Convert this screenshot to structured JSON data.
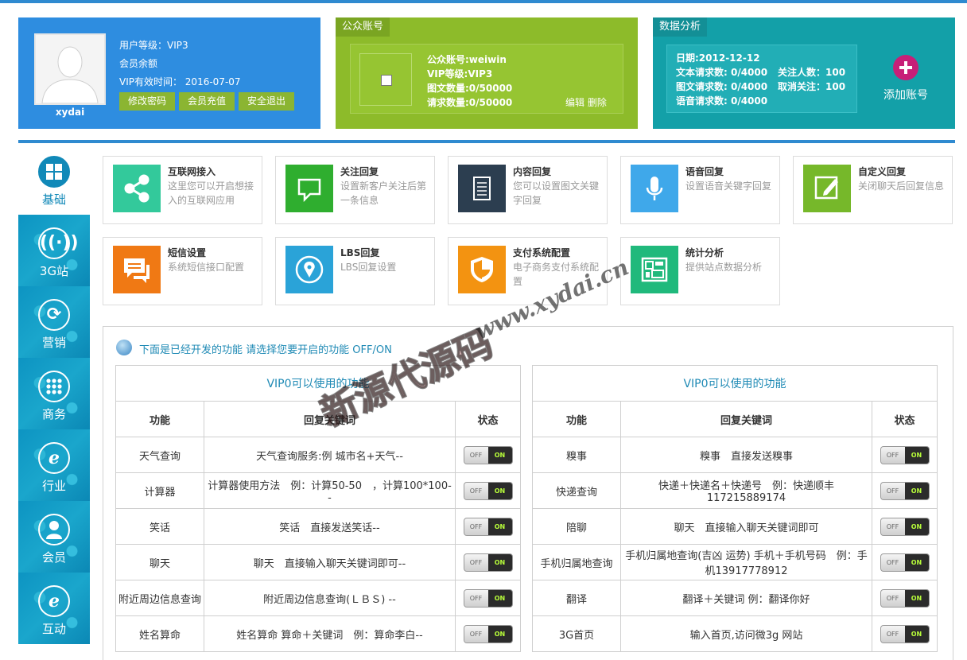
{
  "user": {
    "name": "xydai",
    "level": "用户等级：VIP3",
    "balance": "会员余额",
    "expire": "VIP有效时间： 2016-07-07",
    "buttons": [
      "修改密码",
      "会员充值",
      "安全退出"
    ]
  },
  "account": {
    "title": "公众账号",
    "lines": [
      "公众账号:weiwin",
      "VIP等级:VIP3",
      "图文数量:0/50000",
      "请求数量:0/50000"
    ],
    "edit": "编辑",
    "delete": "删除"
  },
  "data": {
    "title": "数据分析",
    "date": "日期:2012-12-12",
    "text_req": "文本请求数: 0/4000",
    "img_req": "图文请求数: 0/4000",
    "voice_req": "语音请求数: 0/4000",
    "follow": "关注人数：100",
    "unfollow": "取消关注：100",
    "add": "添加账号"
  },
  "sidebar": [
    {
      "label": "基础",
      "icon": "grid-icon"
    },
    {
      "label": "3G站",
      "icon": "signal-icon"
    },
    {
      "label": "营销",
      "icon": "refresh-icon"
    },
    {
      "label": "商务",
      "icon": "dots-grid-icon"
    },
    {
      "label": "行业",
      "icon": "ie-icon"
    },
    {
      "label": "会员",
      "icon": "person-icon"
    },
    {
      "label": "互动",
      "icon": "ie-icon"
    }
  ],
  "cards": [
    {
      "title": "互联网接入",
      "desc": "这里您可以开启想接入的互联网应用",
      "color": "#33c99b",
      "icon": "share-icon"
    },
    {
      "title": "关注回复",
      "desc": "设置新客户关注后第一条信息",
      "color": "#2fae2f",
      "icon": "speech-bubble-icon"
    },
    {
      "title": "内容回复",
      "desc": "您可以设置图文关键字回复",
      "color": "#2c3e50",
      "icon": "document-icon"
    },
    {
      "title": "语音回复",
      "desc": "设置语音关键字回复",
      "color": "#3fa8ea",
      "icon": "microphone-icon"
    },
    {
      "title": "自定义回复",
      "desc": "关闭聊天后回复信息",
      "color": "#76b82a",
      "icon": "edit-icon"
    },
    {
      "title": "短信设置",
      "desc": "系统短信接口配置",
      "color": "#f07914",
      "icon": "chat-icon"
    },
    {
      "title": "LBS回复",
      "desc": "LBS回复设置",
      "color": "#2aa3d8",
      "icon": "location-icon"
    },
    {
      "title": "支付系统配置",
      "desc": "电子商务支付系统配置",
      "color": "#f39311",
      "icon": "shield-icon"
    },
    {
      "title": "统计分析",
      "desc": "提供站点数据分析",
      "color": "#20b97c",
      "icon": "dashboard-icon"
    }
  ],
  "notice": "下面是已经开发的功能 请选择您要开启的功能 OFF/ON",
  "table_left": {
    "caption": "VIP0可以使用的功能",
    "headers": [
      "功能",
      "回复关键词",
      "状态"
    ],
    "rows": [
      [
        "天气查询",
        "天气查询服务:例 城市名+天气--"
      ],
      [
        "计算器",
        "计算器使用方法　例：计算50-50　，计算100*100--"
      ],
      [
        "笑话",
        "笑话　直接发送笑话--"
      ],
      [
        "聊天",
        "聊天　直接输入聊天关键词即可--"
      ],
      [
        "附近周边信息查询",
        "附近周边信息查询(ＬＢＳ) --"
      ],
      [
        "姓名算命",
        "姓名算命 算命＋关键词　例：算命李白--"
      ]
    ]
  },
  "table_right": {
    "caption": "VIP0可以使用的功能",
    "headers": [
      "功能",
      "回复关键词",
      "状态"
    ],
    "rows": [
      [
        "糗事",
        "糗事　直接发送糗事"
      ],
      [
        "快递查询",
        "快递＋快递名＋快递号　例：快递顺丰117215889174"
      ],
      [
        "陪聊",
        "聊天　直接输入聊天关键词即可"
      ],
      [
        "手机归属地查询",
        "手机归属地查询(吉凶 运势) 手机＋手机号码　例：手机13917778912"
      ],
      [
        "翻译",
        "翻译＋关键词 例：翻译你好"
      ],
      [
        "3G首页",
        "输入首页,访问微3g 网站"
      ]
    ]
  },
  "toggle": {
    "off": "OFF",
    "on": "ON"
  },
  "watermark": {
    "text": "新源代源码",
    "url": "www.xydai.cn"
  }
}
